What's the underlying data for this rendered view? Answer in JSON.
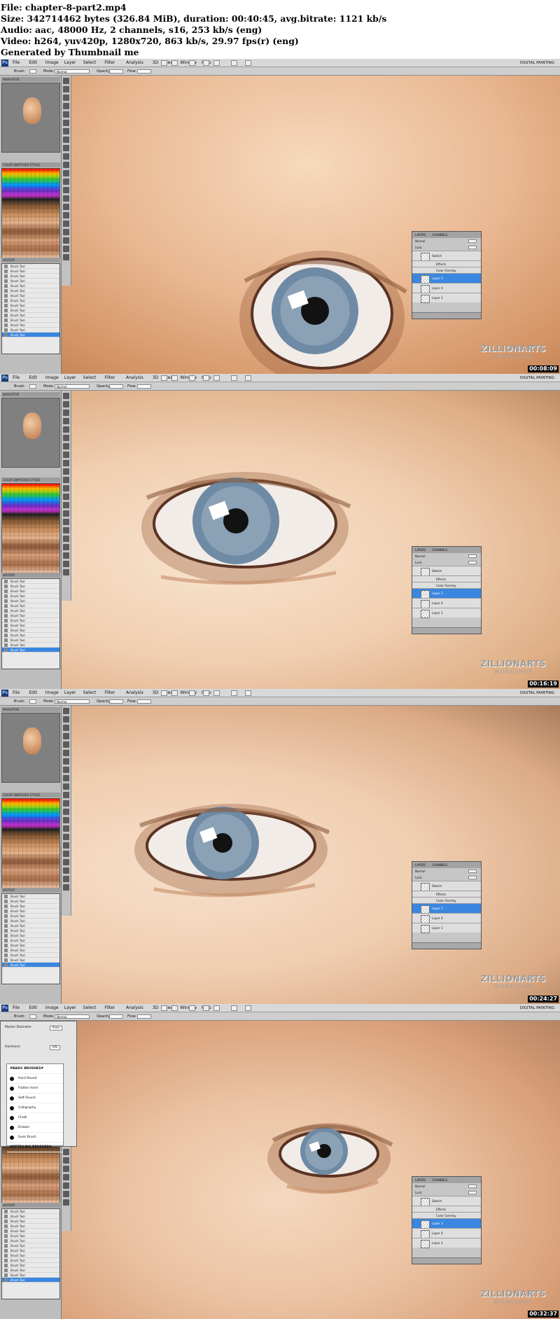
{
  "info": {
    "file": "File: chapter-8-part2.mp4",
    "size": "Size: 342714462 bytes (326.84 MiB), duration: 00:40:45, avg.bitrate: 1121 kb/s",
    "audio": "Audio: aac, 48000 Hz, 2 channels, s16, 253 kb/s (eng)",
    "video": "Video: h264, yuv420p, 1280x720, 863 kb/s, 29.97 fps(r) (eng)",
    "generated": "Generated by Thumbnail me"
  },
  "app": {
    "menu": [
      "File",
      "Edit",
      "Image",
      "Layer",
      "Select",
      "Filter",
      "Analysis",
      "3D",
      "View",
      "Window",
      "Help"
    ],
    "workspace": "DIGITAL PAINTING",
    "options": {
      "brush_label": "Brush:",
      "mode_label": "Mode:",
      "mode_value": "Normal",
      "opacity_label": "Opacity:",
      "flow_label": "Flow:"
    }
  },
  "panels": {
    "navigator_title": "NAVIGATOR",
    "swatches_tabs": "COLOR  SWATCHES  STYLES",
    "history_title": "HISTORY",
    "history_item": "Brush Tool"
  },
  "layers_panel": {
    "tabs": [
      "LAYERS",
      "CHANNELS"
    ],
    "blend": "Normal",
    "opacity_label": "Opacity:",
    "lock_label": "Lock:",
    "fill_label": "Fill:"
  },
  "frames": [
    {
      "timestamp": "00:08:09",
      "layers": [
        "Sketch",
        "Effects",
        "Color Overlay",
        "Layer 3",
        "Layer 4",
        "Layer 1"
      ],
      "selected": 3
    },
    {
      "timestamp": "00:16:19",
      "layers": [
        "Sketch",
        "Effects",
        "Color Overlay",
        "Layer 3",
        "Layer 4",
        "Layer 1"
      ],
      "selected": 3
    },
    {
      "timestamp": "00:24:27",
      "layers": [
        "Sketch",
        "Effects",
        "Color Overlay",
        "Layer 3",
        "Layer 4",
        "Layer 1"
      ],
      "selected": 3
    },
    {
      "timestamp": "00:32:37",
      "layers": [
        "Sketch",
        "Effects",
        "Color Overlay",
        "Layer 3",
        "Layer 4",
        "Layer 1"
      ],
      "selected": 3
    }
  ],
  "brush_picker": {
    "master_diameter_label": "Master Diameter",
    "diameter_value": "9 px",
    "hardness_label": "Hardness:",
    "hardness_value": "0%",
    "items": [
      "#BASIC BRUSHES#",
      "Hard Round",
      "Flatten Hard",
      "Soft Round",
      "Calligraphy",
      "Chalk",
      "Drawer",
      "Sumi Brush",
      "#DETAILING BRUSHES#"
    ]
  },
  "watermark": {
    "line1": "ZILLIONARTS",
    "line2": "WORKSHOP"
  },
  "colors": {
    "ui_gray": "#bdbdbd",
    "selected_blue": "#3a86e0",
    "skin_light": "#f4d3b3",
    "iris": "#6f8aa4"
  }
}
